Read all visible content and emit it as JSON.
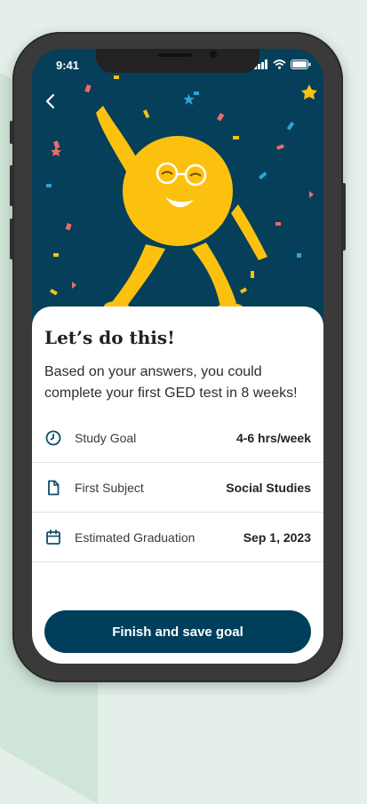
{
  "status_bar": {
    "time": "9:41"
  },
  "header": {
    "back_icon": "chevron-left-icon"
  },
  "colors": {
    "hero_bg": "#053f5a",
    "mascot": "#fcc10f",
    "cta_bg": "#003f5c",
    "accent_icon": "#0e4d68"
  },
  "card": {
    "title": "Let’s do this!",
    "description": "Based on your answers, you could complete your first GED test in 8 weeks!",
    "rows": [
      {
        "icon": "clock-icon",
        "label": "Study Goal",
        "value": "4-6 hrs/week"
      },
      {
        "icon": "document-icon",
        "label": "First Subject",
        "value": "Social Studies"
      },
      {
        "icon": "calendar-icon",
        "label": "Estimated Graduation",
        "value": "Sep 1, 2023"
      }
    ],
    "cta_label": "Finish and save goal"
  }
}
